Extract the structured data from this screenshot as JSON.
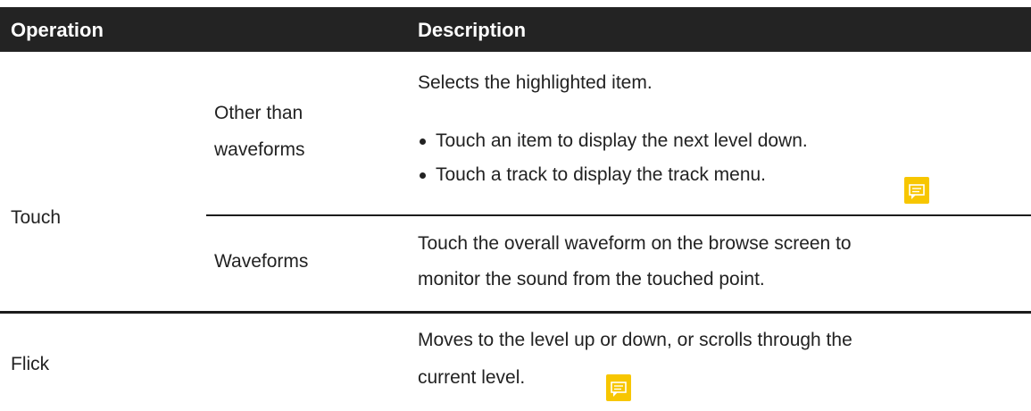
{
  "table": {
    "headers": {
      "operation": "Operation",
      "description": "Description"
    },
    "rows": [
      {
        "operation": "Touch",
        "sub_rows": [
          {
            "target": "Other than waveforms",
            "description": "Selects the highlighted item.",
            "bullets": [
              "Touch an item to display the next level down.",
              "Touch a track to display the track menu."
            ],
            "has_comment_icon": true
          },
          {
            "target": "Waveforms",
            "description_lines": [
              "Touch the overall waveform on the browse screen to",
              "monitor the sound from the touched point."
            ]
          }
        ]
      },
      {
        "operation": "Flick",
        "description_lines": [
          "Moves to the level up or down, or scrolls through the",
          "current level."
        ],
        "has_comment_icon": true
      }
    ]
  },
  "icons": {
    "comment": "comment-icon"
  },
  "colors": {
    "header_background": "#232323",
    "header_text": "#ffffff",
    "comment_icon": "#f7c600"
  }
}
